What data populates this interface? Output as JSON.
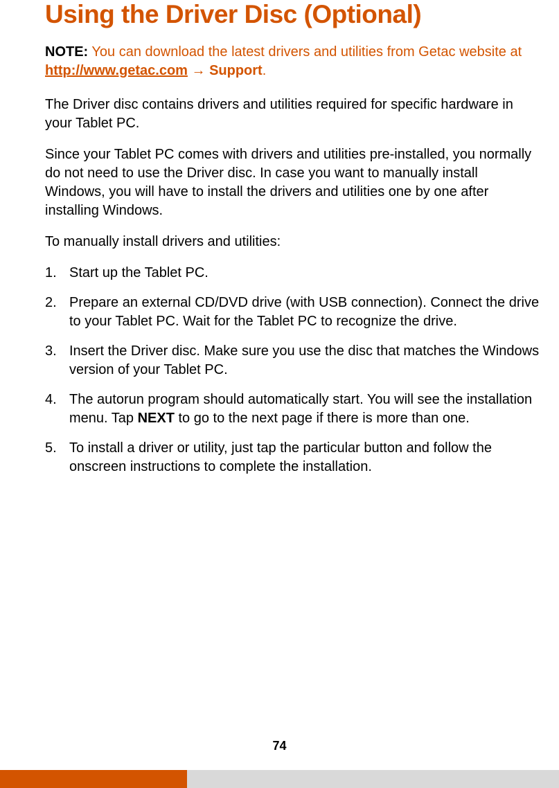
{
  "heading": "Using the Driver Disc (Optional)",
  "note": {
    "label": "NOTE:",
    "prefix": " You can download the latest drivers and utilities from Getac website at ",
    "link": "http://www.getac.com",
    "arrow": " → ",
    "support": "Support",
    "period": "."
  },
  "para1": "The Driver disc contains drivers and utilities required for specific hardware in your Tablet PC.",
  "para2": "Since your Tablet PC comes with drivers and utilities pre-installed, you normally do not need to use the Driver disc. In case you want to manually install Windows, you will have to install the drivers and utilities one by one after installing Windows.",
  "para3": "To manually install drivers and utilities:",
  "steps": {
    "s1": "Start up the Tablet PC.",
    "s2": "Prepare an external CD/DVD drive (with USB connection). Connect the drive to your Tablet PC. Wait for the Tablet PC to recognize the drive.",
    "s3": "Insert the Driver disc. Make sure you use the disc that matches the Windows version of your Tablet PC.",
    "s4_a": "The autorun program should automatically start. You will see the installation menu. Tap ",
    "s4_bold": "NEXT",
    "s4_b": " to go to the next page if there is more than one.",
    "s5": "To install a driver or utility, just tap the particular button and follow the onscreen instructions to complete the installation."
  },
  "pageNumber": "74"
}
